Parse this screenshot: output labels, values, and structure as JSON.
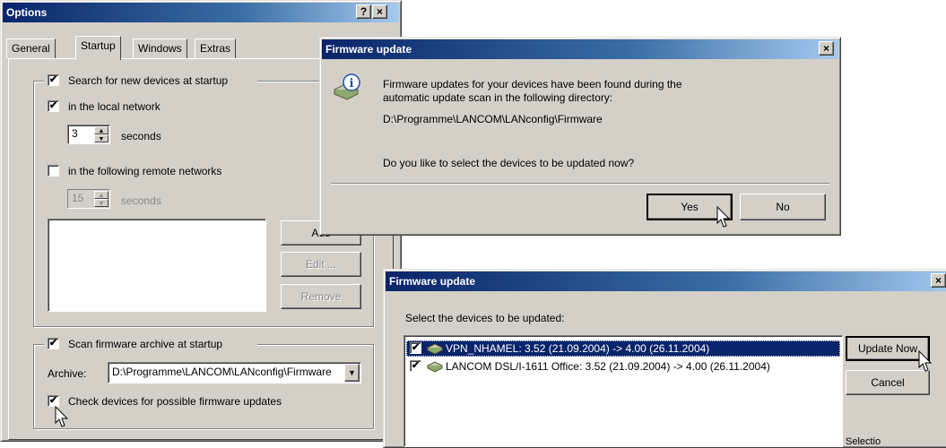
{
  "options": {
    "title": "Options",
    "help_btn": "?",
    "close_btn": "×",
    "tabs": [
      "General",
      "Startup",
      "Windows",
      "Extras"
    ],
    "search_devices": {
      "label": "Search for new devices at startup",
      "checked": true
    },
    "local_network": {
      "label": "in the local network",
      "checked": true
    },
    "local_seconds": {
      "value": "3",
      "unit": "seconds"
    },
    "remote_networks": {
      "label": "in the following remote networks",
      "checked": false
    },
    "remote_seconds": {
      "value": "15",
      "unit": "seconds"
    },
    "buttons": {
      "add": "Add",
      "edit": "Edit ...",
      "remove": "Remove"
    },
    "scan_archive": {
      "label": "Scan firmware archive at startup",
      "checked": true
    },
    "archive_label": "Archive:",
    "archive_value": "D:\\Programme\\LANCOM\\LANconfig\\Firmware",
    "check_devices": {
      "label": "Check devices for possible firmware updates",
      "checked": true
    }
  },
  "fw_dialog1": {
    "title": "Firmware update",
    "close_btn": "×",
    "message_line1": "Firmware updates for your devices have been found during the",
    "message_line2": "automatic update scan in the following directory:",
    "path": "D:\\Programme\\LANCOM\\LANconfig\\Firmware",
    "question": "Do you like to select the devices to be updated now?",
    "yes_btn": "Yes",
    "no_btn": "No"
  },
  "fw_dialog2": {
    "title": "Firmware update",
    "close_btn": "×",
    "instruction": "Select the devices to be updated:",
    "devices": [
      {
        "label": "VPN_NHAMEL: 3.52 (21.09.2004) -> 4.00 (26.11.2004)",
        "checked": true,
        "selected": true
      },
      {
        "label": "LANCOM DSL/I-1611 Office: 3.52 (21.09.2004) -> 4.00 (26.11.2004)",
        "checked": true,
        "selected": false
      }
    ],
    "update_now_btn": "Update Now",
    "cancel_btn": "Cancel",
    "partial_label": "Selectio"
  },
  "colors": {
    "title_bar": "#0a246a",
    "face": "#d4d0c8",
    "selection": "#0a246a"
  },
  "icons": [
    "info-icon",
    "device-icon",
    "mouse-cursor-icon",
    "checkmark-icon",
    "spin-up-icon",
    "spin-down-icon",
    "dropdown-arrow-icon"
  ]
}
